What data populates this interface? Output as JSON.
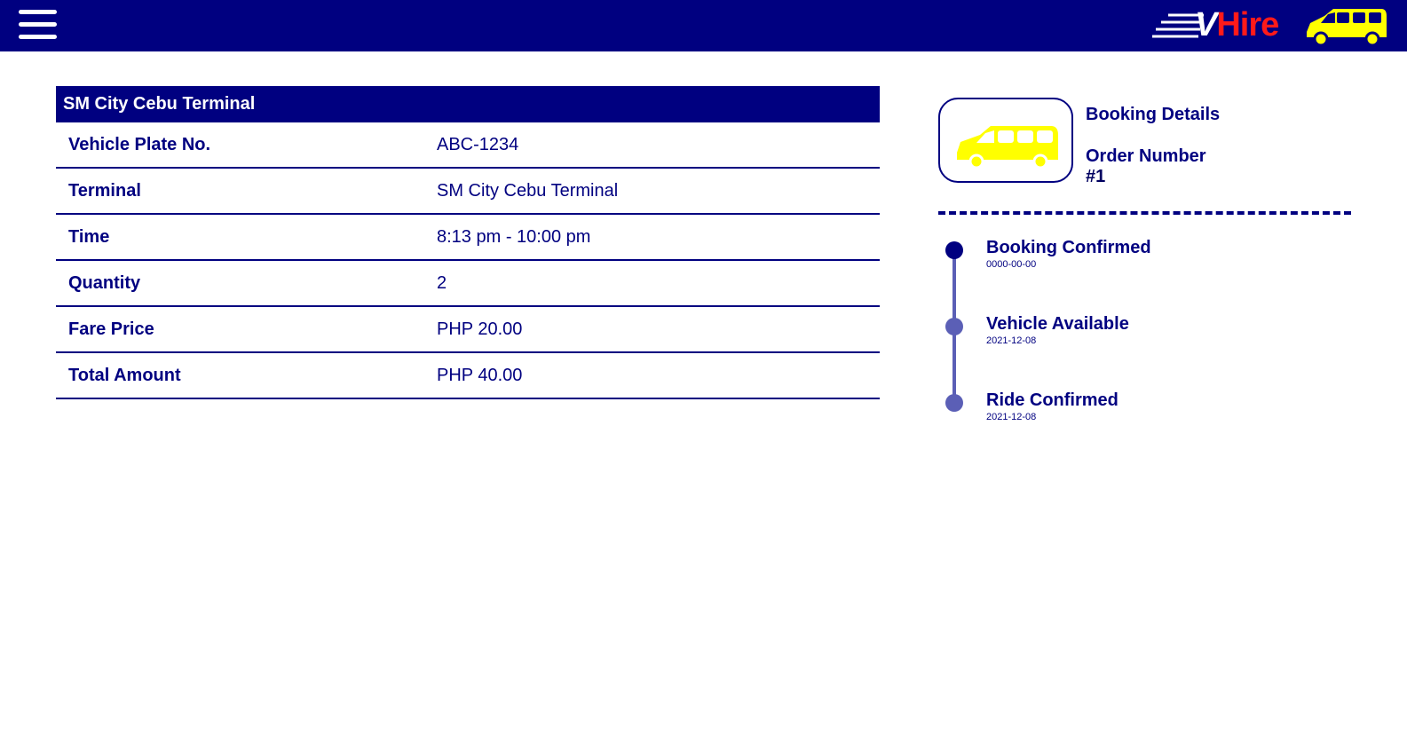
{
  "header": {
    "menu_icon": "hamburger-menu-icon",
    "brand": {
      "v": "V",
      "hire": "Hire"
    },
    "colors": {
      "bar": "#000080",
      "brand_red": "#ff1a1a",
      "van": "#ffff00"
    }
  },
  "details": {
    "title": "SM City Cebu Terminal",
    "rows": [
      {
        "label": "Vehicle Plate No.",
        "value": "ABC-1234"
      },
      {
        "label": "Terminal",
        "value": "SM City Cebu Terminal"
      },
      {
        "label": "Time",
        "value": "8:13 pm - 10:00 pm"
      },
      {
        "label": "Quantity",
        "value": "2"
      },
      {
        "label": "Fare Price",
        "value": "PHP 20.00"
      },
      {
        "label": "Total Amount",
        "value": "PHP 40.00"
      }
    ]
  },
  "booking": {
    "title": "Booking Details",
    "order_label": "Order Number",
    "order_value": "#1",
    "icon": "van-icon"
  },
  "timeline": [
    {
      "title": "Booking Confirmed",
      "date": "0000-00-00",
      "color": "#000080"
    },
    {
      "title": "Vehicle Available",
      "date": "2021-12-08",
      "color": "#5b5fb6"
    },
    {
      "title": "Ride Confirmed",
      "date": "2021-12-08",
      "color": "#5b5fb6"
    }
  ]
}
